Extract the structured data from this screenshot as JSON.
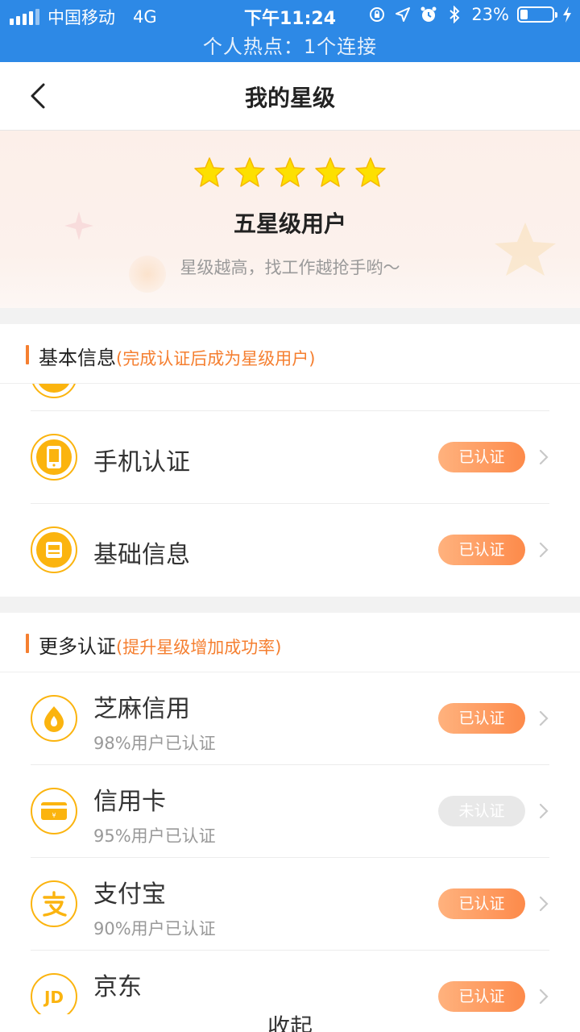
{
  "status_bar": {
    "carrier": "中国移动",
    "network": "4G",
    "time": "下午11:24",
    "battery_percent": "23%",
    "battery_level": 0.23,
    "hotspot": "个人热点：1个连接"
  },
  "nav": {
    "title": "我的星级"
  },
  "hero": {
    "star_count": 5,
    "title": "五星级用户",
    "subtitle": "星级越高，找工作越抢手哟～"
  },
  "basic": {
    "title": "基本信息",
    "hint": "(完成认证后成为星级用户)",
    "items": [
      {
        "label": "手机认证",
        "status": "已认证",
        "icon": "phone-icon"
      },
      {
        "label": "基础信息",
        "status": "已认证",
        "icon": "id-card-icon"
      }
    ]
  },
  "more": {
    "title": "更多认证",
    "hint": "(提升星级增加成功率)",
    "items": [
      {
        "label": "芝麻信用",
        "sub": "98%用户已认证",
        "status": "已认证",
        "icon": "sesame-credit-icon"
      },
      {
        "label": "信用卡",
        "sub": "95%用户已认证",
        "status": "未认证",
        "icon": "credit-card-icon"
      },
      {
        "label": "支付宝",
        "sub": "90%用户已认证",
        "status": "已认证",
        "icon": "alipay-icon"
      },
      {
        "label": "京东",
        "sub": "",
        "status": "已认证",
        "icon": "jd-icon"
      }
    ]
  },
  "footer": {
    "collapse_label": "收起"
  },
  "colors": {
    "status_bar": "#2d89e6",
    "accent_orange": "#f57f30",
    "icon_yellow": "#fbb40f",
    "badge_verified_start": "#ffb27e",
    "badge_verified_end": "#fd8a4a",
    "badge_unverified": "#e8e8e8"
  }
}
